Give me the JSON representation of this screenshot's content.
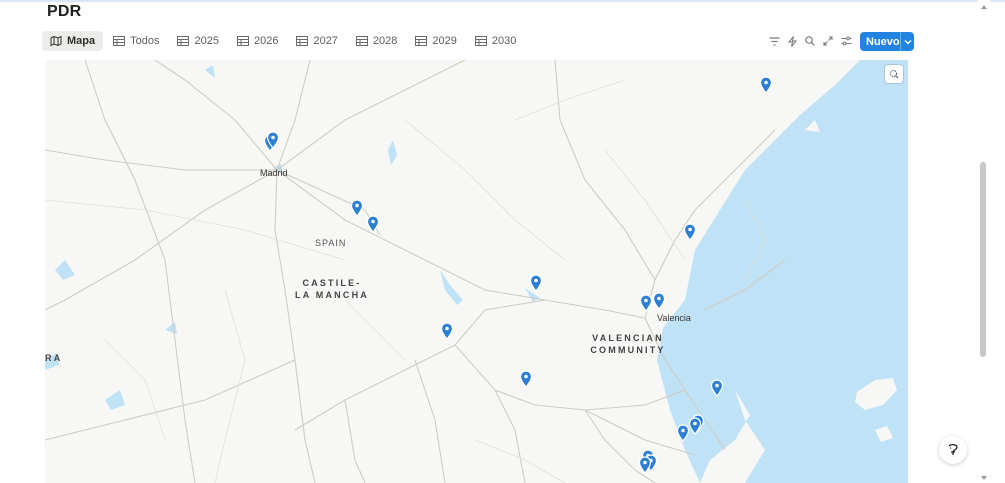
{
  "page": {
    "title": "PDR"
  },
  "views": [
    {
      "label": "Mapa",
      "icon": "map-icon",
      "active": true
    },
    {
      "label": "Todos",
      "icon": "table-icon",
      "active": false
    },
    {
      "label": "2025",
      "icon": "table-icon",
      "active": false
    },
    {
      "label": "2026",
      "icon": "table-icon",
      "active": false
    },
    {
      "label": "2027",
      "icon": "table-icon",
      "active": false
    },
    {
      "label": "2028",
      "icon": "table-icon",
      "active": false
    },
    {
      "label": "2029",
      "icon": "table-icon",
      "active": false
    },
    {
      "label": "2030",
      "icon": "table-icon",
      "active": false
    }
  ],
  "toolbar": {
    "icons": [
      "filter-icon",
      "automation-bolt-icon",
      "search-icon",
      "expand-icon",
      "settings-sliders-icon"
    ],
    "new_label": "Nuevo"
  },
  "map": {
    "labels": {
      "madrid": "Madrid",
      "spain": "SPAIN",
      "castile_1": "CASTILE-",
      "castile_2": "LA MANCHA",
      "valencian_1": "VALENCIAN",
      "valencian_2": "COMMUNITY",
      "valencia": "Valencia",
      "edge": "RA"
    },
    "marker_count": 18,
    "colors": {
      "land": "#f7f7f5",
      "water": "#bfe2f6",
      "marker": "#2d7fd3",
      "road": "#c9c6bd"
    }
  },
  "colors": {
    "accent": "#2383e2"
  }
}
